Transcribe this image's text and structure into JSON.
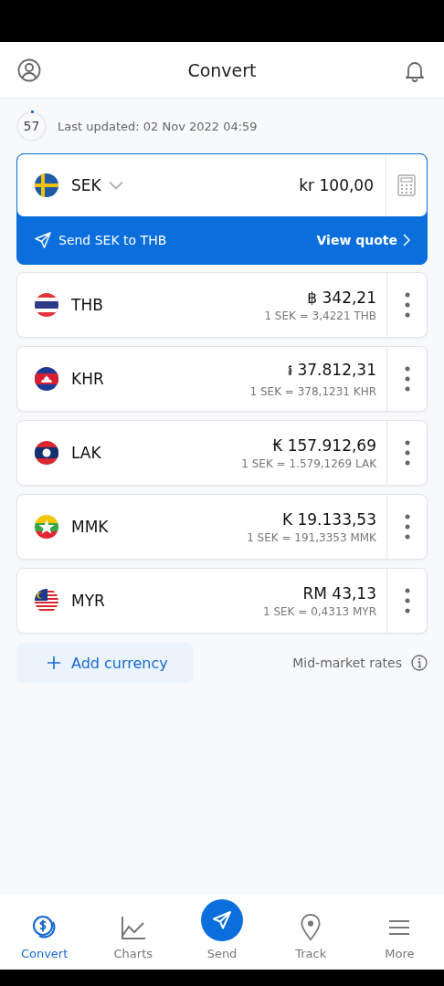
{
  "header": {
    "title": "Convert"
  },
  "refresh": {
    "countdown": "57",
    "last_updated": "Last updated: 02 Nov 2022 04:59"
  },
  "base": {
    "kind": "se",
    "code": "SEK",
    "amount": "kr 100,00",
    "send_label": "Send SEK to THB",
    "quote_label": "View quote"
  },
  "currencies": [
    {
      "kind": "th",
      "code": "THB",
      "amount": "฿ 342,21",
      "rate": "1 SEK = 3,4221 THB"
    },
    {
      "kind": "kh",
      "code": "KHR",
      "amount": "៛ 37.812,31",
      "rate": "1 SEK = 378,1231 KHR"
    },
    {
      "kind": "la",
      "code": "LAK",
      "amount": "₭ 157.912,69",
      "rate": "1 SEK = 1.579,1269 LAK"
    },
    {
      "kind": "mm",
      "code": "MMK",
      "amount": "K 19.133,53",
      "rate": "1 SEK = 191,3353 MMK"
    },
    {
      "kind": "my",
      "code": "MYR",
      "amount": "RM 43,13",
      "rate": "1 SEK = 0,4313 MYR"
    }
  ],
  "add_button": "Add currency",
  "rates_note": "Mid-market rates",
  "nav": [
    {
      "kind": "coins",
      "label": "Convert",
      "selected": true
    },
    {
      "kind": "chart",
      "label": "Charts",
      "selected": false
    },
    {
      "kind": "send",
      "label": "Send",
      "selected": false
    },
    {
      "kind": "pin",
      "label": "Track",
      "selected": false
    },
    {
      "kind": "menu",
      "label": "More",
      "selected": false
    }
  ]
}
